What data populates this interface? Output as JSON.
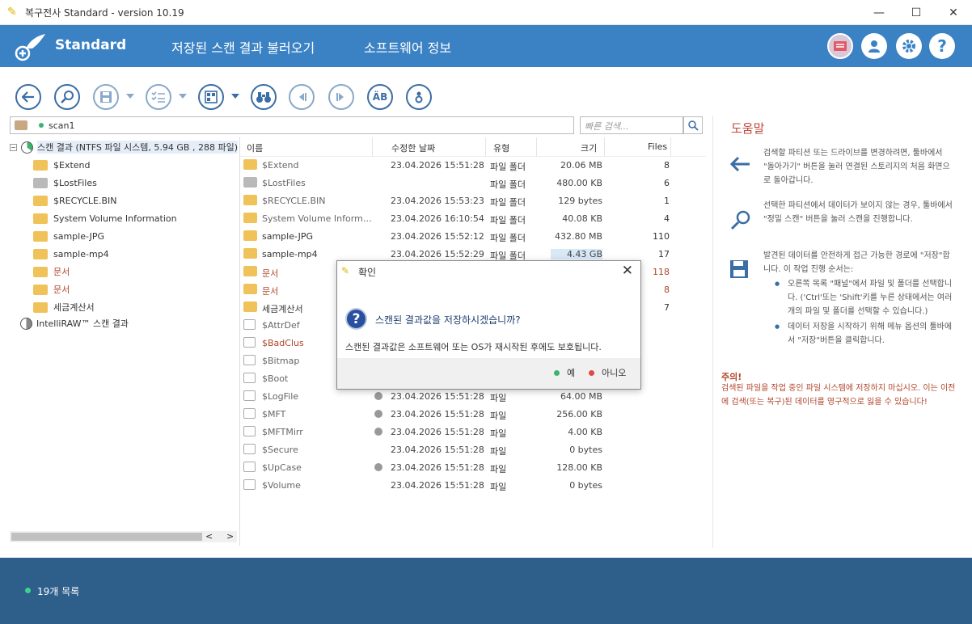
{
  "window": {
    "title": "복구전사 Standard - version 10.19",
    "min": "—",
    "max": "☐",
    "close": "✕"
  },
  "header": {
    "brand": "Standard",
    "menu": [
      "저장된 스캔 결과 불러오기",
      "소프트웨어 정보"
    ],
    "help_btn": "?",
    "accent": "#3b82c4"
  },
  "path": {
    "value": "scan1",
    "search_placeholder": "빠른 검색..."
  },
  "tree": {
    "root": "스캔 결과 (NTFS 파일 시스템, 5.94 GB , 288 파일)",
    "items": [
      "$Extend",
      "$LostFiles",
      "$RECYCLE.BIN",
      "System Volume Information",
      "sample-JPG",
      "sample-mp4",
      "문서",
      "문서",
      "세금계산서"
    ],
    "intelliraw": "IntelliRAW™ 스캔 결과"
  },
  "list": {
    "headers": [
      "이름",
      "수정한 날짜",
      "유형",
      "크기",
      "Files"
    ],
    "rows": [
      {
        "name": "$Extend",
        "date": "23.04.2026 15:51:28",
        "type": "파일 폴더",
        "size": "20.06 MB",
        "files": "8"
      },
      {
        "name": "$LostFiles",
        "date": "",
        "type": "파일 폴더",
        "size": "480.00 KB",
        "files": "6"
      },
      {
        "name": "$RECYCLE.BIN",
        "date": "23.04.2026 15:53:23",
        "type": "파일 폴더",
        "size": "129 bytes",
        "files": "1"
      },
      {
        "name": "System Volume Informati...",
        "date": "23.04.2026 16:10:54",
        "type": "파일 폴더",
        "size": "40.08 KB",
        "files": "4"
      },
      {
        "name": "sample-JPG",
        "date": "23.04.2026 15:52:12",
        "type": "파일 폴더",
        "size": "432.80 MB",
        "files": "110"
      },
      {
        "name": "sample-mp4",
        "date": "23.04.2026 15:52:29",
        "type": "파일 폴더",
        "size": "4.43 GB",
        "files": "17"
      },
      {
        "name": "문서",
        "date": "",
        "type": "",
        "size": "",
        "files": "118"
      },
      {
        "name": "문서",
        "date": "",
        "type": "",
        "size": "",
        "files": "8"
      },
      {
        "name": "세금계산서",
        "date": "",
        "type": "",
        "size": "",
        "files": "7"
      },
      {
        "name": "$AttrDef",
        "date": "",
        "type": "",
        "size": "",
        "files": ""
      },
      {
        "name": "$BadClus",
        "date": "",
        "type": "",
        "size": "",
        "files": ""
      },
      {
        "name": "$Bitmap",
        "date": "",
        "type": "",
        "size": "",
        "files": ""
      },
      {
        "name": "$Boot",
        "date": "",
        "type": "",
        "size": "",
        "files": ""
      },
      {
        "name": "$LogFile",
        "date": "23.04.2026 15:51:28",
        "type": "파일",
        "size": "64.00 MB",
        "files": ""
      },
      {
        "name": "$MFT",
        "date": "23.04.2026 15:51:28",
        "type": "파일",
        "size": "256.00 KB",
        "files": ""
      },
      {
        "name": "$MFTMirr",
        "date": "23.04.2026 15:51:28",
        "type": "파일",
        "size": "4.00 KB",
        "files": ""
      },
      {
        "name": "$Secure",
        "date": "23.04.2026 15:51:28",
        "type": "파일",
        "size": "0 bytes",
        "files": ""
      },
      {
        "name": "$UpCase",
        "date": "23.04.2026 15:51:28",
        "type": "파일",
        "size": "128.00 KB",
        "files": ""
      },
      {
        "name": "$Volume",
        "date": "23.04.2026 15:51:28",
        "type": "파일",
        "size": "0 bytes",
        "files": ""
      }
    ]
  },
  "help": {
    "title": "도움말",
    "p1": "검색할 파티션 또는 드라이브를 변경하려면, 툴바에서 \"돌아가기\" 버튼을 눌러 연결된 스토리지의 처음 화면으로 돌아갑니다.",
    "p2": "선택한 파티션에서 데이터가 보이지 않는 경우, 툴바에서 \"정밀 스캔\" 버튼을 눌러 스캔을 진행합니다.",
    "p3": "발견된 데이터를 안전하게 접근 가능한 경로에 \"저장\"합니다. 이 작업 진행 순서는:",
    "li1": "오른쪽 목록 \"패널\"에서 파일 및 폴더를 선택합니다. ('Ctrl'또는 'Shift'키를 누른 상태에서는 여러개의 파일 및 폴더를 선택할 수 있습니다.)",
    "li2": "데이터 저장을 시작하기 위해 메뉴 옵션의 툴바에서 \"저장\"버튼을 클릭합니다.",
    "warn_title": "주의!",
    "warn_text": "검색된 파일을 작업 중인 파일 시스템에 저장하지 마십시오. 이는 이전에 검색(또는 복구)된 데이터를 영구적으로 잃을 수 있습니다!"
  },
  "status": {
    "text": "19개 목록"
  },
  "dialog": {
    "title": "확인",
    "question": "스캔된 결과값을 저장하시겠습니까?",
    "message": "스캔된 결과값은 소프트웨어 또는 OS가 재시작된 후에도 보호됩니다.",
    "yes": "예",
    "no": "아니오"
  },
  "toolbar": {
    "text_btn": "ÄB"
  }
}
